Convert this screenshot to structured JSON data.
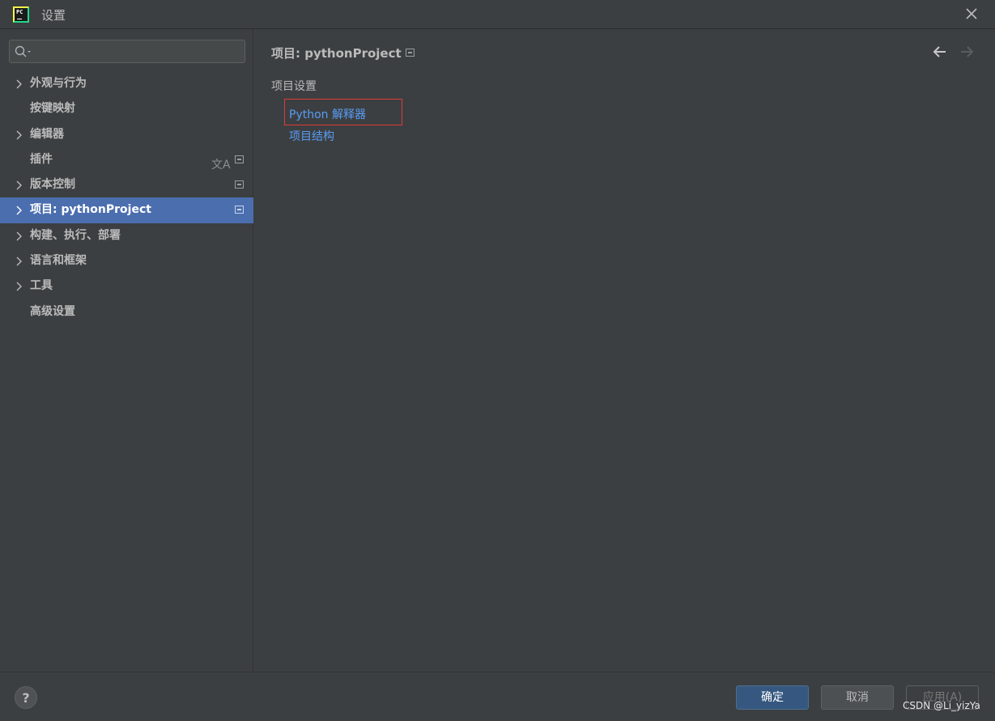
{
  "window": {
    "title": "设置"
  },
  "search": {
    "placeholder": "",
    "value": ""
  },
  "sidebar": {
    "items": [
      {
        "label": "外观与行为",
        "expandable": true,
        "selected": false
      },
      {
        "label": "按键映射",
        "expandable": false,
        "selected": false
      },
      {
        "label": "编辑器",
        "expandable": true,
        "selected": false
      },
      {
        "label": "插件",
        "expandable": false,
        "selected": false,
        "icons": [
          "translate-icon",
          "project-scope-icon"
        ]
      },
      {
        "label": "版本控制",
        "expandable": true,
        "selected": false,
        "icons": [
          "project-scope-icon"
        ]
      },
      {
        "label": "项目: pythonProject",
        "expandable": true,
        "selected": true,
        "icons": [
          "project-scope-icon"
        ]
      },
      {
        "label": "构建、执行、部署",
        "expandable": true,
        "selected": false
      },
      {
        "label": "语言和框架",
        "expandable": true,
        "selected": false
      },
      {
        "label": "工具",
        "expandable": true,
        "selected": false
      },
      {
        "label": "高级设置",
        "expandable": false,
        "selected": false
      }
    ],
    "translate_glyph": "文A"
  },
  "content": {
    "breadcrumb": "项目: pythonProject",
    "section_title": "项目设置",
    "links": [
      {
        "label": "Python 解释器",
        "highlighted": true
      },
      {
        "label": "项目结构",
        "highlighted": false
      }
    ]
  },
  "footer": {
    "help": "?",
    "ok": "确定",
    "cancel": "取消",
    "apply": "应用(A)",
    "watermark": "CSDN @Li_yizYa"
  },
  "colors": {
    "background": "#3c3f41",
    "selection": "#4b6eaf",
    "link": "#589df6",
    "highlight_border": "#e03a3a",
    "primary_button": "#365880"
  }
}
